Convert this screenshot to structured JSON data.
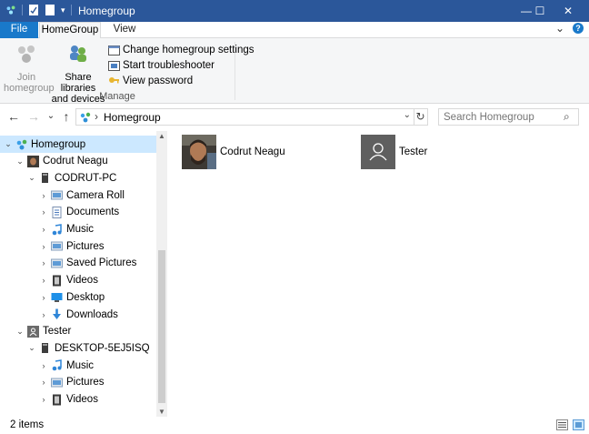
{
  "window": {
    "title": "Homegroup",
    "controls": {
      "minimize": "—",
      "maximize": "☐",
      "close": "✕"
    }
  },
  "ribbon_tabs": [
    {
      "label": "File"
    },
    {
      "label": "HomeGroup"
    },
    {
      "label": "View"
    }
  ],
  "ribbon_controls": {
    "expand": "⌄",
    "help": "?"
  },
  "ribbon": {
    "join_label_1": "Join",
    "join_label_2": "homegroup",
    "share_label_1": "Share libraries",
    "share_label_2": "and devices",
    "change_settings": "Change homegroup settings",
    "troubleshooter": "Start troubleshooter",
    "view_password": "View password",
    "group_label": "Manage"
  },
  "address": {
    "separator": "›",
    "path": "Homegroup",
    "dropdown": "⌄",
    "search_placeholder": "Search Homegroup"
  },
  "nav_glyphs": {
    "back": "←",
    "forward": "→",
    "recent": "⌄",
    "up": "↑",
    "refresh": "↻",
    "search": "⌕"
  },
  "tree": [
    {
      "label": "Homegroup",
      "chevron": "⌄",
      "icon": "homegroup-icon",
      "selected": true
    },
    {
      "label": "Codrut Neagu",
      "chevron": "⌄",
      "icon": "user-photo-icon"
    },
    {
      "label": "CODRUT-PC",
      "chevron": "⌄",
      "icon": "computer-icon"
    },
    {
      "label": "Camera Roll",
      "chevron": "›",
      "icon": "pictures-folder-icon"
    },
    {
      "label": "Documents",
      "chevron": "›",
      "icon": "documents-icon"
    },
    {
      "label": "Music",
      "chevron": "›",
      "icon": "music-icon"
    },
    {
      "label": "Pictures",
      "chevron": "›",
      "icon": "pictures-folder-icon"
    },
    {
      "label": "Saved Pictures",
      "chevron": "›",
      "icon": "pictures-folder-icon"
    },
    {
      "label": "Videos",
      "chevron": "›",
      "icon": "videos-icon"
    },
    {
      "label": "Desktop",
      "chevron": "›",
      "icon": "desktop-icon"
    },
    {
      "label": "Downloads",
      "chevron": "›",
      "icon": "downloads-icon"
    },
    {
      "label": "Tester",
      "chevron": "⌄",
      "icon": "user-icon"
    },
    {
      "label": "DESKTOP-5EJ5ISQ",
      "chevron": "⌄",
      "icon": "computer-icon"
    },
    {
      "label": "Music",
      "chevron": "›",
      "icon": "music-icon"
    },
    {
      "label": "Pictures",
      "chevron": "›",
      "icon": "pictures-folder-icon"
    },
    {
      "label": "Videos",
      "chevron": "›",
      "icon": "videos-icon"
    }
  ],
  "scroll_glyphs": {
    "up": "▲",
    "down": "▼"
  },
  "content_items": [
    {
      "name": "Codrut Neagu",
      "icon": "user-photo-icon"
    },
    {
      "name": "Tester",
      "icon": "user-icon"
    }
  ],
  "status": {
    "count": "2 items"
  },
  "colors": {
    "title_bar": "#2b579a",
    "file_tab": "#1979ca",
    "selection": "#cce8ff",
    "ribbon_bg": "#f5f6f7"
  }
}
